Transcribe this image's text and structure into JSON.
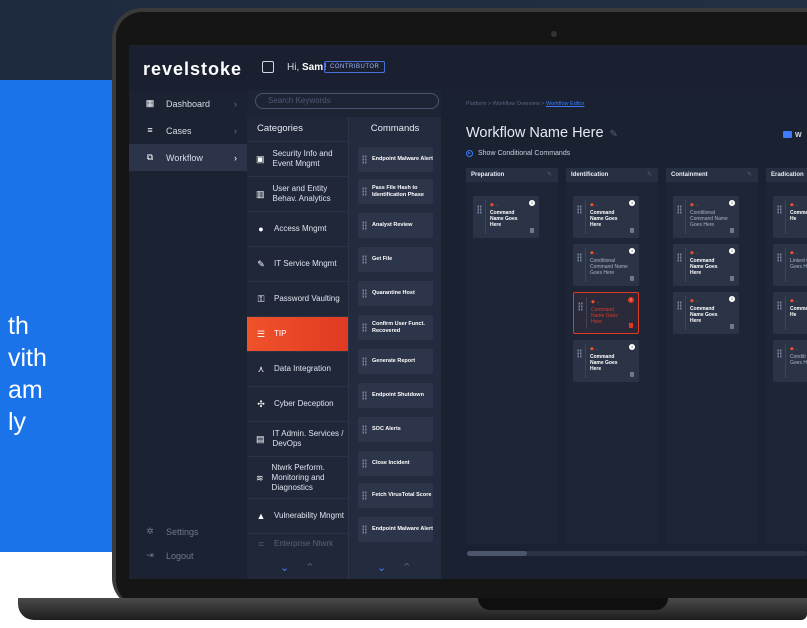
{
  "promo": {
    "lines": [
      "th",
      "vith",
      "am",
      "ly"
    ]
  },
  "app": {
    "logo": "revelstoke",
    "greeting_prefix": "Hi, ",
    "user_name": "Sam!",
    "role_badge": "CONTRIBUTOR"
  },
  "sidebar": {
    "items": [
      {
        "label": "Dashboard",
        "icon": "dashboard-icon"
      },
      {
        "label": "Cases",
        "icon": "list-icon"
      },
      {
        "label": "Workflow",
        "icon": "workflow-icon",
        "active": true
      }
    ],
    "bottom": [
      {
        "label": "Settings",
        "icon": "gear-icon"
      },
      {
        "label": "Logout",
        "icon": "logout-icon"
      }
    ]
  },
  "search": {
    "placeholder": "Search Keywords"
  },
  "categories": {
    "header": "Categories",
    "items": [
      "Security Info and Event Mngmt",
      "User and Entity Behav. Analytics",
      "Access Mngmt",
      "IT Service Mngmt",
      "Password Vaulting",
      "TIP",
      "Data Integration",
      "Cyber Deception",
      "IT Admin. Services / DevOps",
      "Ntwrk Perform. Monitoring and Diagnostics",
      "Vulnerability Mngmt",
      "Enterprise Ntwrk"
    ],
    "active": "TIP"
  },
  "commands": {
    "header": "Commands",
    "items": [
      "Endpoint Malware Alert",
      "Pass File Hash to Identification Phase",
      "Analyst Review",
      "Get File",
      "Quarantine Host",
      "Confirm User Funct. Recovered",
      "Generate Report",
      "Endpoint Shutdown",
      "SOC Alerts",
      "Close Incident",
      "Fetch VirusTotal Score",
      "Endpoint Malware Alert"
    ]
  },
  "workflow": {
    "breadcrumb": [
      "Platform",
      "Workflow Overview"
    ],
    "breadcrumb_link": "Workflow Editor",
    "breadcrumb_sep": " > ",
    "title": "Workflow Name Here",
    "show_conditional": "Show Conditional Commands",
    "action_label": "W",
    "stages": [
      {
        "name": "Preparation",
        "cards": [
          {
            "text": "Command Name Goes Here",
            "type": "normal"
          }
        ]
      },
      {
        "name": "Identification",
        "cards": [
          {
            "text": "Command Name Goes Here",
            "type": "normal"
          },
          {
            "text": "Conditional Command Name Goes Here",
            "type": "conditional"
          },
          {
            "text": "Command Name Goes Here",
            "type": "error"
          },
          {
            "text": "Command Name Goes Here",
            "type": "normal"
          }
        ]
      },
      {
        "name": "Containment",
        "cards": [
          {
            "text": "Conditional Command Name Goes Here",
            "type": "conditional"
          },
          {
            "text": "Command Name Goes Here",
            "type": "normal"
          },
          {
            "text": "Command Name Goes Here",
            "type": "normal"
          }
        ]
      },
      {
        "name": "Eradication",
        "cards": [
          {
            "text": "Comma Goes He",
            "type": "normal"
          },
          {
            "text": "Linked Comma Goes He",
            "type": "conditional"
          },
          {
            "text": "Comma Goes He",
            "type": "normal"
          },
          {
            "text": "Conditi Comma Goes He",
            "type": "conditional"
          }
        ]
      }
    ]
  }
}
